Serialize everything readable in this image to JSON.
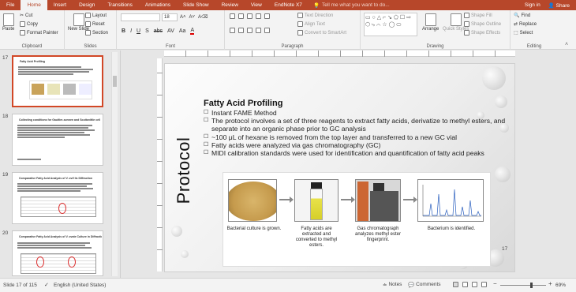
{
  "tabs": [
    "File",
    "Home",
    "Insert",
    "Design",
    "Transitions",
    "Animations",
    "Slide Show",
    "Review",
    "View",
    "EndNote X7"
  ],
  "tell_me": "Tell me what you want to do...",
  "signin": "Sign in",
  "share": "Share",
  "ribbon": {
    "clipboard": {
      "paste": "Paste",
      "cut": "Cut",
      "copy": "Copy",
      "format_painter": "Format Painter",
      "label": "Clipboard"
    },
    "slides": {
      "new_slide": "New Slide",
      "layout": "Layout",
      "reset": "Reset",
      "section": "Section",
      "label": "Slides"
    },
    "font": {
      "font_size": "18",
      "label": "Font"
    },
    "paragraph": {
      "text_direction": "Text Direction",
      "align_text": "Align Text",
      "convert_smartart": "Convert to SmartArt",
      "label": "Paragraph"
    },
    "drawing": {
      "arrange": "Arrange",
      "quick_styles": "Quick Styles",
      "shape_fill": "Shape Fill",
      "shape_outline": "Shape Outline",
      "shape_effects": "Shape Effects",
      "label": "Drawing"
    },
    "editing": {
      "find": "Find",
      "replace": "Replace",
      "select": "Select",
      "label": "Editing"
    }
  },
  "thumbnails": [
    {
      "num": "17",
      "title": "Fatty Acid Profiling"
    },
    {
      "num": "18",
      "title": "Collecting conditions for Gaultier-sonnen and Scuttovittle cell"
    },
    {
      "num": "19",
      "title": "Comparative Fatty Acid Analysis of V. ovif lis Diffraction"
    },
    {
      "num": "20",
      "title": "Comparative Fatty Acid Analysis of V. ovate Culture in Diffraction Conditions"
    }
  ],
  "slide": {
    "vertical_title": "Protocol",
    "title": "Fatty Acid Profiling",
    "bullets": [
      "Instant FAME Method",
      "The protocol involves a set of three reagents to extract fatty acids, derivatize to methyl esters, and separate into an organic phase prior to GC analysis",
      "~100 μL of hexane is removed from the top layer and transferred to a new GC vial",
      "Fatty acids were analyzed via gas chromatography (GC)",
      "MIDI calibration standards were used for identification and quantification of fatty acid peaks"
    ],
    "figure_captions": [
      "Bacterial culture is grown.",
      "Fatty acids are extracted and converted to methyl esters.",
      "Gas chromatograph analyzes methyl ester fingerprint.",
      "Bacterium is identified."
    ],
    "page_number": "17"
  },
  "status": {
    "slide_info": "Slide 17 of 115",
    "language": "English (United States)",
    "notes": "Notes",
    "comments": "Comments",
    "zoom": "69%"
  },
  "colors": {
    "accent": "#b7472a",
    "selected": "#d24726"
  }
}
